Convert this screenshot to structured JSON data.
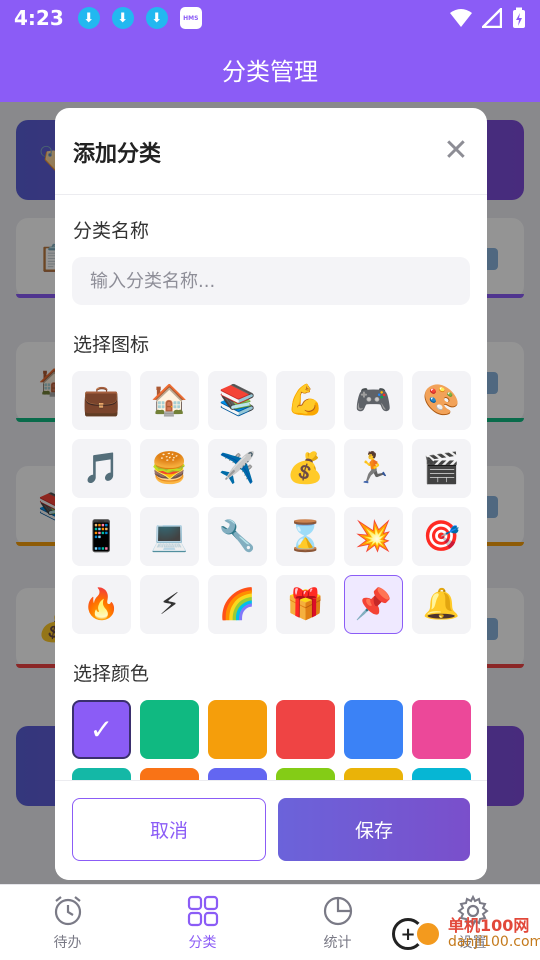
{
  "status_bar": {
    "time": "4:23",
    "notification_icons": [
      "download-icon",
      "download-icon",
      "download-icon"
    ],
    "hms_badge": "HMS"
  },
  "app_bar": {
    "title": "分类管理"
  },
  "dialog": {
    "title": "添加分类",
    "name_label": "分类名称",
    "name_placeholder": "输入分类名称...",
    "name_value": "",
    "icon_label": "选择图标",
    "icons": [
      "💼",
      "🏠",
      "📚",
      "💪",
      "🎮",
      "🎨",
      "🎵",
      "🍔",
      "✈️",
      "💰",
      "🏃",
      "🎬",
      "📱",
      "💻",
      "🔧",
      "⌛",
      "💥",
      "🎯",
      "🔥",
      "⚡",
      "🌈",
      "🎁",
      "📌",
      "🔔"
    ],
    "selected_icon_index": 22,
    "color_label": "选择颜色",
    "colors": [
      "#8b5cf6",
      "#10b981",
      "#f59e0b",
      "#ef4444",
      "#3b82f6",
      "#ec4899",
      "#14b8a6",
      "#f97316",
      "#6366f1",
      "#84cc16",
      "#eab308",
      "#06b6d4"
    ],
    "selected_color_index": 0,
    "selected_mark": "✓",
    "cancel_label": "取消",
    "save_label": "保存"
  },
  "background_cards": {
    "stripe_colors": [
      "#8b5cf6",
      "#10b981",
      "#f59e0b",
      "#ef4444"
    ],
    "leading_icons": [
      "🏷️",
      "📋",
      "🏠",
      "📚",
      "💰"
    ]
  },
  "bottom_nav": [
    {
      "label": "待办",
      "icon": "alarm-clock-icon",
      "active": false
    },
    {
      "label": "分类",
      "icon": "grid-icon",
      "active": true
    },
    {
      "label": "统计",
      "icon": "pie-chart-icon",
      "active": false
    },
    {
      "label": "设置",
      "icon": "gear-icon",
      "active": false
    }
  ],
  "watermark": {
    "line1": "单机100网",
    "line2": "danji100.com"
  }
}
